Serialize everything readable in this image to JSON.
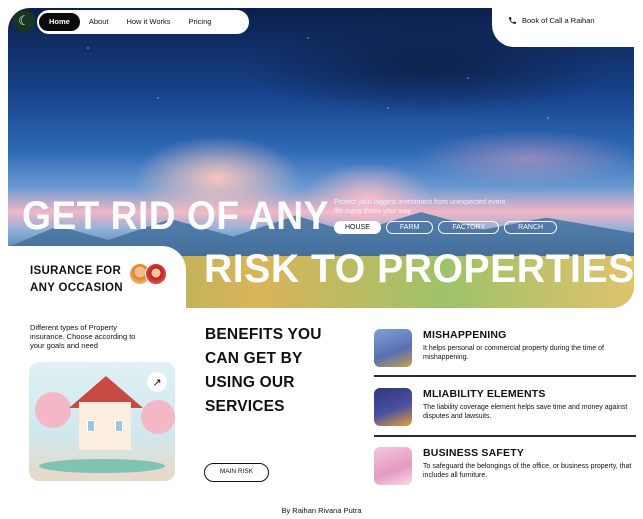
{
  "nav": {
    "items": [
      {
        "label": "Home",
        "active": true
      },
      {
        "label": "About",
        "active": false
      },
      {
        "label": "How it Works",
        "active": false
      },
      {
        "label": "Pricing",
        "active": false
      }
    ],
    "book_call": "Book of Call a Raihan",
    "logo_icon": "crescent-moon-icon"
  },
  "hero": {
    "headline_line1": "GET RID OF ANY",
    "headline_line2": "RISK TO PROPERTIES",
    "tagline": "Protect your biggest investment from unexpected event life many throw your way",
    "filters": [
      {
        "label": "HOUSE",
        "active": true
      },
      {
        "label": "FARM",
        "active": false
      },
      {
        "label": "FACTORY",
        "active": false
      },
      {
        "label": "RANCH",
        "active": false
      }
    ]
  },
  "insurance": {
    "title": "ISURANCE FOR ANY OCCASION",
    "description": "Different types of Property insurance. Choose according to your goals and need"
  },
  "benefits": {
    "title": "BENEFITS YOU CAN GET BY USING OUR SERVICES",
    "button_label": "MAIN RISK"
  },
  "services": [
    {
      "title": "MISHAPPENING",
      "description": "It helps personal or commercial property during the time of mishappening.",
      "thumb_color": "#6f8fc9"
    },
    {
      "title": "MLIABILITY ELEMENTS",
      "description": "The liability coverage element helps save time and money against disputes and lawsuits.",
      "thumb_color": "#3c4a8a"
    },
    {
      "title": "BUSINESS SAFETY",
      "description": "To safeguard the belongings of the office, or business property, that includes all furniture.",
      "thumb_color": "#e9a7c9"
    }
  ],
  "footer": {
    "credit": "By Raihan Rivana Putra"
  },
  "colors": {
    "accent_dark": "#0b0b0b",
    "background": "#ffffff"
  }
}
